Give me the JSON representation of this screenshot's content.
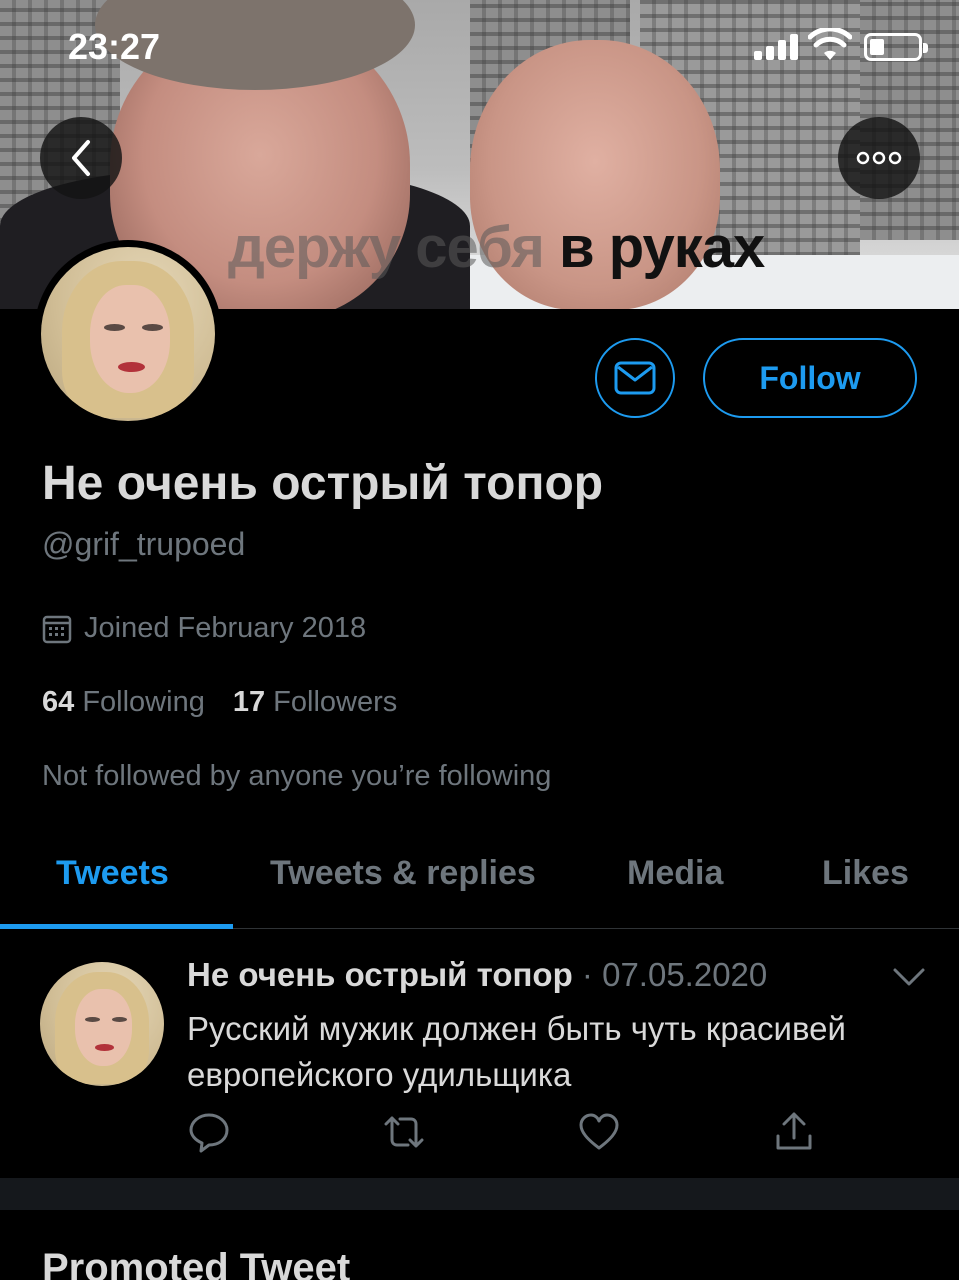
{
  "status_bar": {
    "time": "23:27"
  },
  "banner": {
    "caption_faded": "держу себя",
    "caption_strong": "в руках"
  },
  "profile": {
    "display_name": "Не очень острый топор",
    "handle": "@grif_trupoed",
    "joined": "Joined February 2018",
    "following_count": "64",
    "following_label": "Following",
    "followers_count": "17",
    "followers_label": "Followers",
    "not_followed": "Not followed by anyone you’re following"
  },
  "actions": {
    "follow_label": "Follow"
  },
  "tabs": [
    {
      "label": "Tweets",
      "active": true
    },
    {
      "label": "Tweets & replies",
      "active": false
    },
    {
      "label": "Media",
      "active": false
    },
    {
      "label": "Likes",
      "active": false
    }
  ],
  "tweet": {
    "author": "Не очень острый топор",
    "meta": " · 07.05.2020",
    "text": "Русский мужик должен быть чуть красивей европейского удильщика"
  },
  "promoted_label": "Promoted Tweet",
  "colors": {
    "accent": "#1d9bf0",
    "background": "#000000",
    "secondary_text": "#6e767d"
  },
  "icons": [
    "back-icon",
    "more-icon",
    "mail-icon",
    "calendar-icon",
    "chevron-down-icon",
    "reply-icon",
    "retweet-icon",
    "like-icon",
    "share-icon"
  ]
}
